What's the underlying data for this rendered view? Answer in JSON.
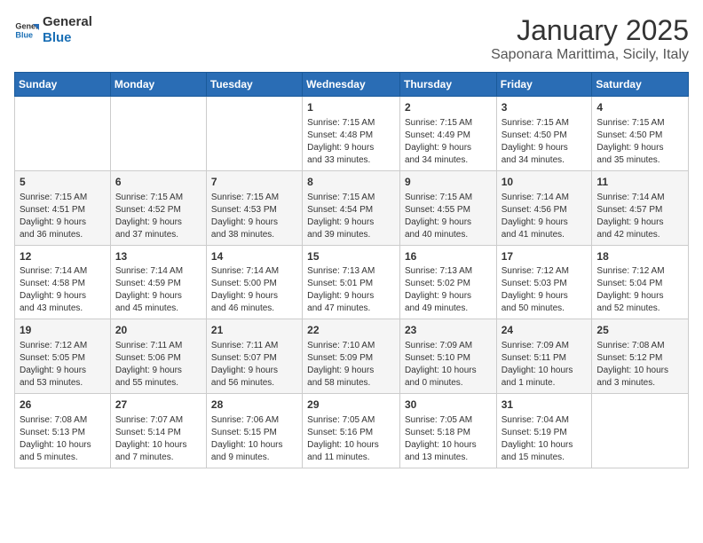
{
  "header": {
    "logo_line1": "General",
    "logo_line2": "Blue",
    "title": "January 2025",
    "subtitle": "Saponara Marittima, Sicily, Italy"
  },
  "weekdays": [
    "Sunday",
    "Monday",
    "Tuesday",
    "Wednesday",
    "Thursday",
    "Friday",
    "Saturday"
  ],
  "weeks": [
    [
      {
        "day": "",
        "info": ""
      },
      {
        "day": "",
        "info": ""
      },
      {
        "day": "",
        "info": ""
      },
      {
        "day": "1",
        "info": "Sunrise: 7:15 AM\nSunset: 4:48 PM\nDaylight: 9 hours\nand 33 minutes."
      },
      {
        "day": "2",
        "info": "Sunrise: 7:15 AM\nSunset: 4:49 PM\nDaylight: 9 hours\nand 34 minutes."
      },
      {
        "day": "3",
        "info": "Sunrise: 7:15 AM\nSunset: 4:50 PM\nDaylight: 9 hours\nand 34 minutes."
      },
      {
        "day": "4",
        "info": "Sunrise: 7:15 AM\nSunset: 4:50 PM\nDaylight: 9 hours\nand 35 minutes."
      }
    ],
    [
      {
        "day": "5",
        "info": "Sunrise: 7:15 AM\nSunset: 4:51 PM\nDaylight: 9 hours\nand 36 minutes."
      },
      {
        "day": "6",
        "info": "Sunrise: 7:15 AM\nSunset: 4:52 PM\nDaylight: 9 hours\nand 37 minutes."
      },
      {
        "day": "7",
        "info": "Sunrise: 7:15 AM\nSunset: 4:53 PM\nDaylight: 9 hours\nand 38 minutes."
      },
      {
        "day": "8",
        "info": "Sunrise: 7:15 AM\nSunset: 4:54 PM\nDaylight: 9 hours\nand 39 minutes."
      },
      {
        "day": "9",
        "info": "Sunrise: 7:15 AM\nSunset: 4:55 PM\nDaylight: 9 hours\nand 40 minutes."
      },
      {
        "day": "10",
        "info": "Sunrise: 7:14 AM\nSunset: 4:56 PM\nDaylight: 9 hours\nand 41 minutes."
      },
      {
        "day": "11",
        "info": "Sunrise: 7:14 AM\nSunset: 4:57 PM\nDaylight: 9 hours\nand 42 minutes."
      }
    ],
    [
      {
        "day": "12",
        "info": "Sunrise: 7:14 AM\nSunset: 4:58 PM\nDaylight: 9 hours\nand 43 minutes."
      },
      {
        "day": "13",
        "info": "Sunrise: 7:14 AM\nSunset: 4:59 PM\nDaylight: 9 hours\nand 45 minutes."
      },
      {
        "day": "14",
        "info": "Sunrise: 7:14 AM\nSunset: 5:00 PM\nDaylight: 9 hours\nand 46 minutes."
      },
      {
        "day": "15",
        "info": "Sunrise: 7:13 AM\nSunset: 5:01 PM\nDaylight: 9 hours\nand 47 minutes."
      },
      {
        "day": "16",
        "info": "Sunrise: 7:13 AM\nSunset: 5:02 PM\nDaylight: 9 hours\nand 49 minutes."
      },
      {
        "day": "17",
        "info": "Sunrise: 7:12 AM\nSunset: 5:03 PM\nDaylight: 9 hours\nand 50 minutes."
      },
      {
        "day": "18",
        "info": "Sunrise: 7:12 AM\nSunset: 5:04 PM\nDaylight: 9 hours\nand 52 minutes."
      }
    ],
    [
      {
        "day": "19",
        "info": "Sunrise: 7:12 AM\nSunset: 5:05 PM\nDaylight: 9 hours\nand 53 minutes."
      },
      {
        "day": "20",
        "info": "Sunrise: 7:11 AM\nSunset: 5:06 PM\nDaylight: 9 hours\nand 55 minutes."
      },
      {
        "day": "21",
        "info": "Sunrise: 7:11 AM\nSunset: 5:07 PM\nDaylight: 9 hours\nand 56 minutes."
      },
      {
        "day": "22",
        "info": "Sunrise: 7:10 AM\nSunset: 5:09 PM\nDaylight: 9 hours\nand 58 minutes."
      },
      {
        "day": "23",
        "info": "Sunrise: 7:09 AM\nSunset: 5:10 PM\nDaylight: 10 hours\nand 0 minutes."
      },
      {
        "day": "24",
        "info": "Sunrise: 7:09 AM\nSunset: 5:11 PM\nDaylight: 10 hours\nand 1 minute."
      },
      {
        "day": "25",
        "info": "Sunrise: 7:08 AM\nSunset: 5:12 PM\nDaylight: 10 hours\nand 3 minutes."
      }
    ],
    [
      {
        "day": "26",
        "info": "Sunrise: 7:08 AM\nSunset: 5:13 PM\nDaylight: 10 hours\nand 5 minutes."
      },
      {
        "day": "27",
        "info": "Sunrise: 7:07 AM\nSunset: 5:14 PM\nDaylight: 10 hours\nand 7 minutes."
      },
      {
        "day": "28",
        "info": "Sunrise: 7:06 AM\nSunset: 5:15 PM\nDaylight: 10 hours\nand 9 minutes."
      },
      {
        "day": "29",
        "info": "Sunrise: 7:05 AM\nSunset: 5:16 PM\nDaylight: 10 hours\nand 11 minutes."
      },
      {
        "day": "30",
        "info": "Sunrise: 7:05 AM\nSunset: 5:18 PM\nDaylight: 10 hours\nand 13 minutes."
      },
      {
        "day": "31",
        "info": "Sunrise: 7:04 AM\nSunset: 5:19 PM\nDaylight: 10 hours\nand 15 minutes."
      },
      {
        "day": "",
        "info": ""
      }
    ]
  ]
}
